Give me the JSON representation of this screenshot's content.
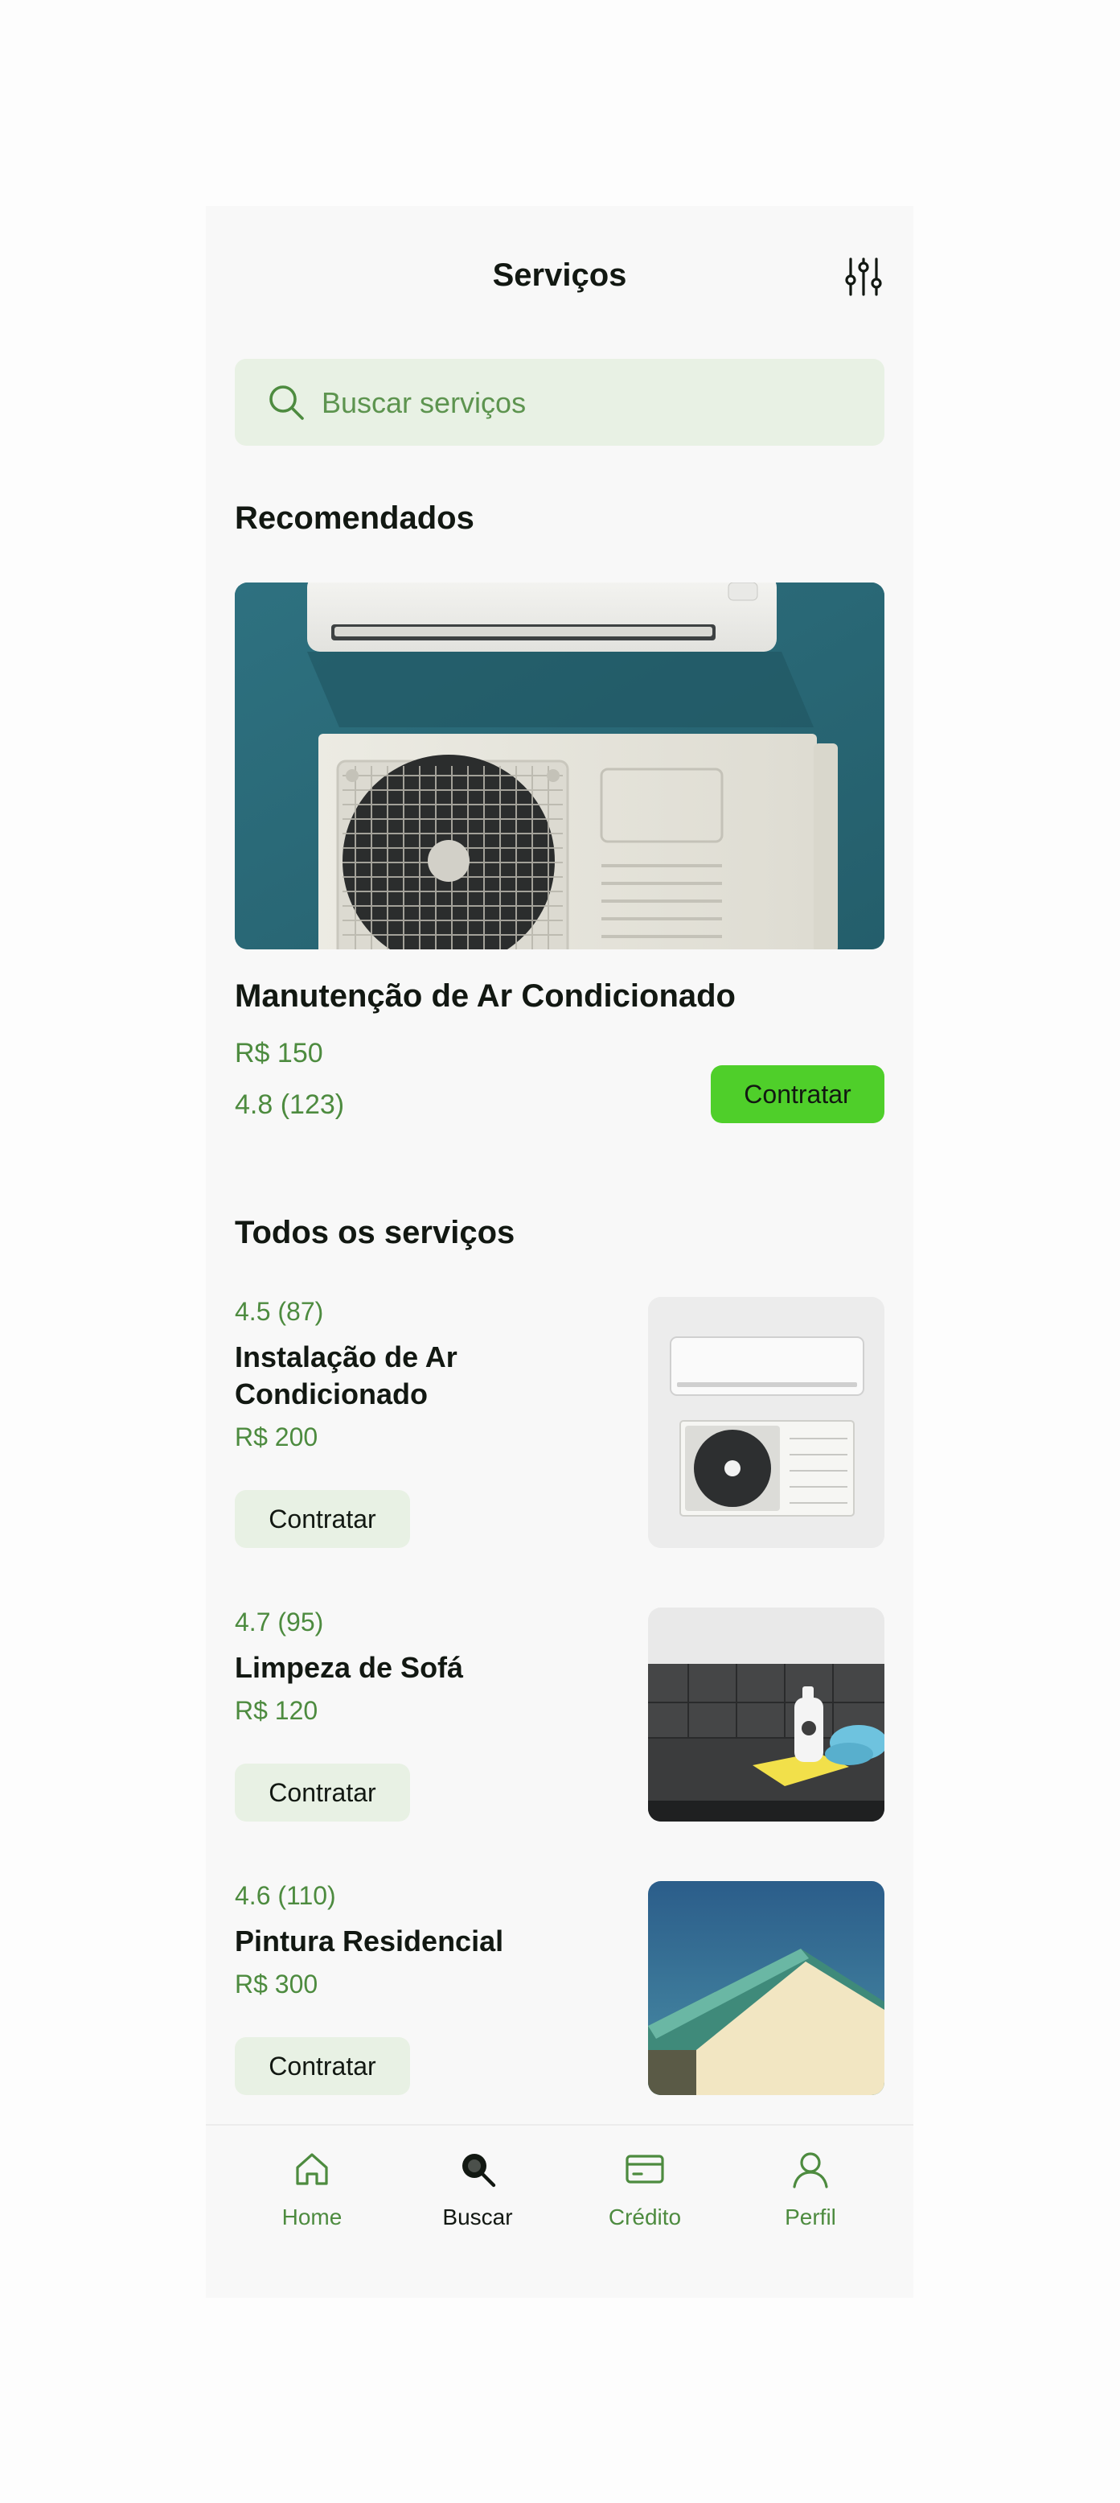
{
  "header": {
    "title": "Serviços",
    "filter_icon": "sliders-icon"
  },
  "search": {
    "placeholder": "Buscar serviços",
    "icon": "search-icon"
  },
  "recommended": {
    "section_title": "Recomendados",
    "name": "Manutenção de Ar Condicionado",
    "price": "R$ 150",
    "rating": "4.8 (123)",
    "button_label": "Contratar"
  },
  "all_services": {
    "section_title": "Todos os serviços",
    "items": [
      {
        "rating": "4.5 (87)",
        "name": "Instalação de Ar Condicionado",
        "price": "R$ 200",
        "button_label": "Contratar"
      },
      {
        "rating": "4.7 (95)",
        "name": "Limpeza de Sofá",
        "price": "R$ 120",
        "button_label": "Contratar"
      },
      {
        "rating": "4.6 (110)",
        "name": "Pintura Residencial",
        "price": "R$ 300",
        "button_label": "Contratar"
      }
    ]
  },
  "bottom_nav": {
    "items": [
      {
        "label": "Home",
        "icon": "home-icon",
        "active": false
      },
      {
        "label": "Buscar",
        "icon": "search-icon",
        "active": true
      },
      {
        "label": "Crédito",
        "icon": "credit-card-icon",
        "active": false
      },
      {
        "label": "Perfil",
        "icon": "user-icon",
        "active": false
      }
    ]
  },
  "colors": {
    "accent": "#4fcf2a",
    "accent_text": "#4d8b3f",
    "light_green_bg": "#e8f1e4",
    "background": "#f8f8f8",
    "text": "#121812"
  }
}
